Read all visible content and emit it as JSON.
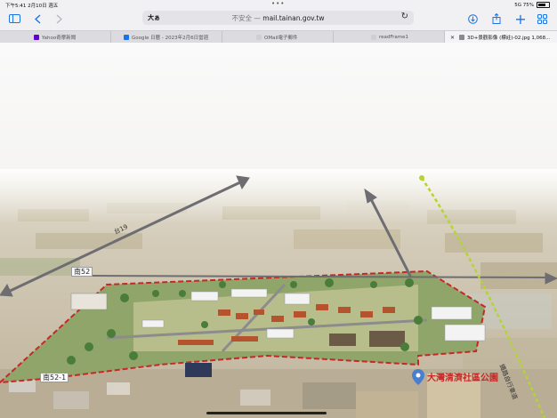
{
  "status_bar": {
    "time_date": "下午5:41  2月10日 週五",
    "dots": "•••",
    "signal": "5G 75%"
  },
  "toolbar": {
    "text_size_button": "大ぁ",
    "address_insecure": "不安全 — ",
    "address_domain": "mail.tainan.gov.tw"
  },
  "tabs": [
    {
      "label": "Yahoo奇摩新聞",
      "favicon_color": "#5f01d1"
    },
    {
      "label": "Google 日曆 - 2023年2月6日當週",
      "favicon_color": "#1a73e8"
    },
    {
      "label": "OMail電子郵件",
      "favicon_color": "#cccccc"
    },
    {
      "label": "readFrame1",
      "favicon_color": "#cccccc"
    },
    {
      "label": "3D+景觀影像 (標註)-02.jpg 1,068...",
      "favicon_color": "#888888"
    }
  ],
  "image": {
    "labels": {
      "tai19": "台19",
      "nan52": "南52",
      "nan52_1": "南52-1",
      "bikeway": "鐵路自行車道",
      "park": "大灣清濟社區公園"
    },
    "colors": {
      "boundary": "#c62828",
      "arrow": "#6d6d72",
      "bike_arrow": "#b5d335"
    }
  }
}
